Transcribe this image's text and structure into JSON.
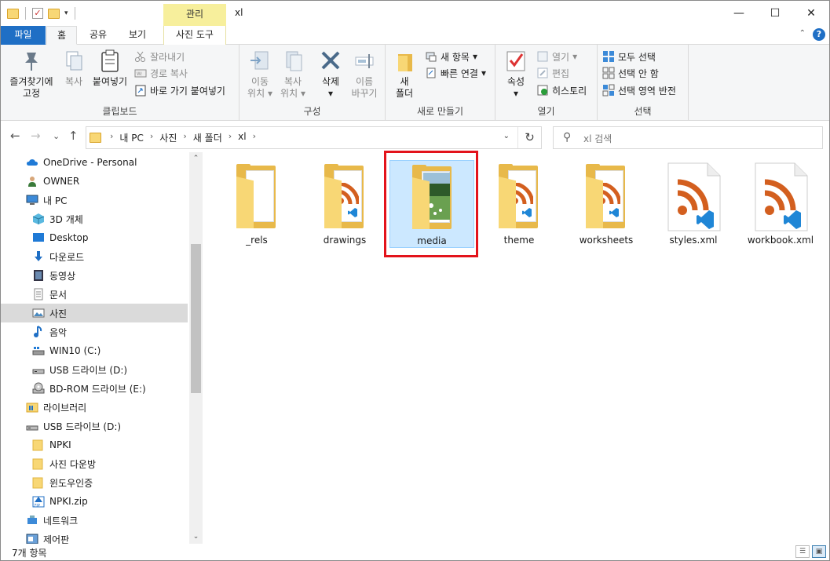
{
  "window": {
    "title": "xl",
    "manage_tab": "관리",
    "minimize": "—",
    "maximize": "☐",
    "close": "✕"
  },
  "tabs": {
    "file": "파일",
    "home": "홈",
    "share": "공유",
    "view": "보기",
    "picture_tools": "사진 도구",
    "help": "?"
  },
  "ribbon": {
    "clipboard": {
      "label": "클립보드",
      "pin_line1": "즐겨찾기에",
      "pin_line2": "고정",
      "copy": "복사",
      "paste": "붙여넣기",
      "cut": "잘라내기",
      "copy_path": "경로 복사",
      "paste_shortcut": "바로 가기 붙여넣기"
    },
    "organize": {
      "label": "구성",
      "move_line1": "이동",
      "move_line2": "위치",
      "copy_line1": "복사",
      "copy_line2": "위치",
      "delete": "삭제",
      "rename_line1": "이름",
      "rename_line2": "바꾸기"
    },
    "new": {
      "label": "새로 만들기",
      "new_folder_line1": "새",
      "new_folder_line2": "폴더",
      "new_item": "새 항목",
      "easy_access": "빠른 연결"
    },
    "open": {
      "label": "열기",
      "properties": "속성",
      "open": "열기",
      "edit": "편집",
      "history": "히스토리"
    },
    "select": {
      "label": "선택",
      "select_all": "모두 선택",
      "select_none": "선택 안 함",
      "invert": "선택 영역 반전"
    }
  },
  "nav": {
    "back": "←",
    "forward": "→",
    "recent": "⌄",
    "up": "↑"
  },
  "address": {
    "crumbs": [
      "내 PC",
      "사진",
      "새 폴더",
      "xl"
    ],
    "sep": "›",
    "refresh": "↻"
  },
  "search": {
    "placeholder": "xl 검색"
  },
  "navpane": {
    "items": [
      {
        "label": "OneDrive - Personal",
        "icon": "cloud-icon"
      },
      {
        "label": "OWNER",
        "icon": "user-icon"
      },
      {
        "label": "내 PC",
        "icon": "pc-icon"
      },
      {
        "label": "3D 개체",
        "icon": "cube-icon"
      },
      {
        "label": "Desktop",
        "icon": "desktop-icon"
      },
      {
        "label": "다운로드",
        "icon": "download-icon"
      },
      {
        "label": "동영상",
        "icon": "video-icon"
      },
      {
        "label": "문서",
        "icon": "document-icon"
      },
      {
        "label": "사진",
        "icon": "picture-icon"
      },
      {
        "label": "음악",
        "icon": "music-icon"
      },
      {
        "label": "WIN10 (C:)",
        "icon": "drive-icon"
      },
      {
        "label": "USB 드라이브 (D:)",
        "icon": "usb-icon"
      },
      {
        "label": "BD-ROM 드라이브 (E:)",
        "icon": "disc-icon"
      },
      {
        "label": "라이브러리",
        "icon": "library-icon"
      },
      {
        "label": "USB 드라이브 (D:)",
        "icon": "usb-icon"
      },
      {
        "label": "NPKI",
        "icon": "folder-icon"
      },
      {
        "label": "사진 다운방",
        "icon": "folder-icon"
      },
      {
        "label": "윈도우인증",
        "icon": "folder-icon"
      },
      {
        "label": "NPKI.zip",
        "icon": "zip-icon"
      },
      {
        "label": "네트워크",
        "icon": "network-icon"
      },
      {
        "label": "제어판",
        "icon": "control-panel-icon"
      }
    ]
  },
  "files": [
    {
      "name": "_rels",
      "type": "folder"
    },
    {
      "name": "drawings",
      "type": "folder-xml"
    },
    {
      "name": "media",
      "type": "folder-media"
    },
    {
      "name": "theme",
      "type": "folder-xml"
    },
    {
      "name": "worksheets",
      "type": "folder-xml"
    },
    {
      "name": "styles.xml",
      "type": "xml"
    },
    {
      "name": "workbook.xml",
      "type": "xml"
    }
  ],
  "status": {
    "count": "7개 항목"
  },
  "colors": {
    "accent": "#1f6fc5",
    "selection": "#cce8ff",
    "highlight": "#e3131b",
    "folder": "#f8d775",
    "rss": "#d35f1f",
    "vscode": "#1f86d6"
  }
}
